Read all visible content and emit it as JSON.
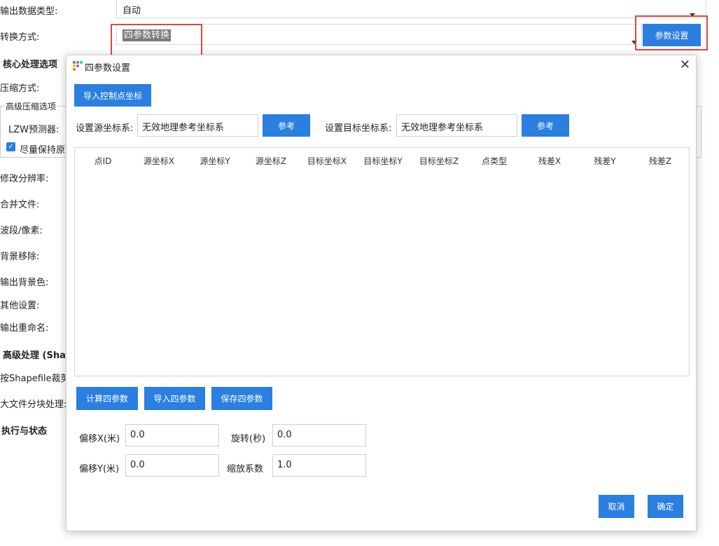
{
  "background": {
    "rows": {
      "output_type_label": "输出数据类型:",
      "output_type_value": "自动",
      "convert_method_label": "转换方式:",
      "convert_method_value": "四参数转换",
      "param_button": "参数设置",
      "core_section": "核心处理选项",
      "compress_label": "压缩方式:",
      "advanced_compress": "高级压缩选项",
      "lzw_label": "LZW预测器:",
      "keep_original": "尽量保持原始",
      "modify_res": "修改分辨率:",
      "merge_files": "合并文件:",
      "bands": "波段/像素:",
      "bg_remove": "背景移除:",
      "output_bg": "输出背景色:",
      "other_settings": "其他设置:",
      "output_rename": "输出重命名:",
      "advanced_section": "高级处理 (Shap",
      "shapefile_clip": "按Shapefile裁剪",
      "large_file": "大文件分块处理:",
      "exec_section": "执行与状态"
    }
  },
  "dialog": {
    "title": "四参数设置",
    "close": "✕",
    "import_ctrl_btn": "导入控制点坐标",
    "src_crs_label": "设置源坐标系:",
    "src_crs_value": "无效地理参考坐标系",
    "src_ref_btn": "参考",
    "dst_crs_label": "设置目标坐标系:",
    "dst_crs_value": "无效地理参考坐标系",
    "dst_ref_btn": "参考",
    "table_columns": [
      "点ID",
      "源坐标X",
      "源坐标Y",
      "源坐标Z",
      "目标坐标X",
      "目标坐标Y",
      "目标坐标Z",
      "点类型",
      "残差X",
      "残差Y",
      "残差Z"
    ],
    "calc_btn": "计算四参数",
    "import_btn": "导入四参数",
    "save_btn": "保存四参数",
    "offset_x_label": "偏移X(米)",
    "offset_x_value": "0.0",
    "rotation_label": "旋转(秒)",
    "rotation_value": "0.0",
    "offset_y_label": "偏移Y(米)",
    "offset_y_value": "0.0",
    "scale_label": "缩放系数",
    "scale_value": "1.0",
    "cancel_btn": "取消",
    "ok_btn": "确定"
  }
}
